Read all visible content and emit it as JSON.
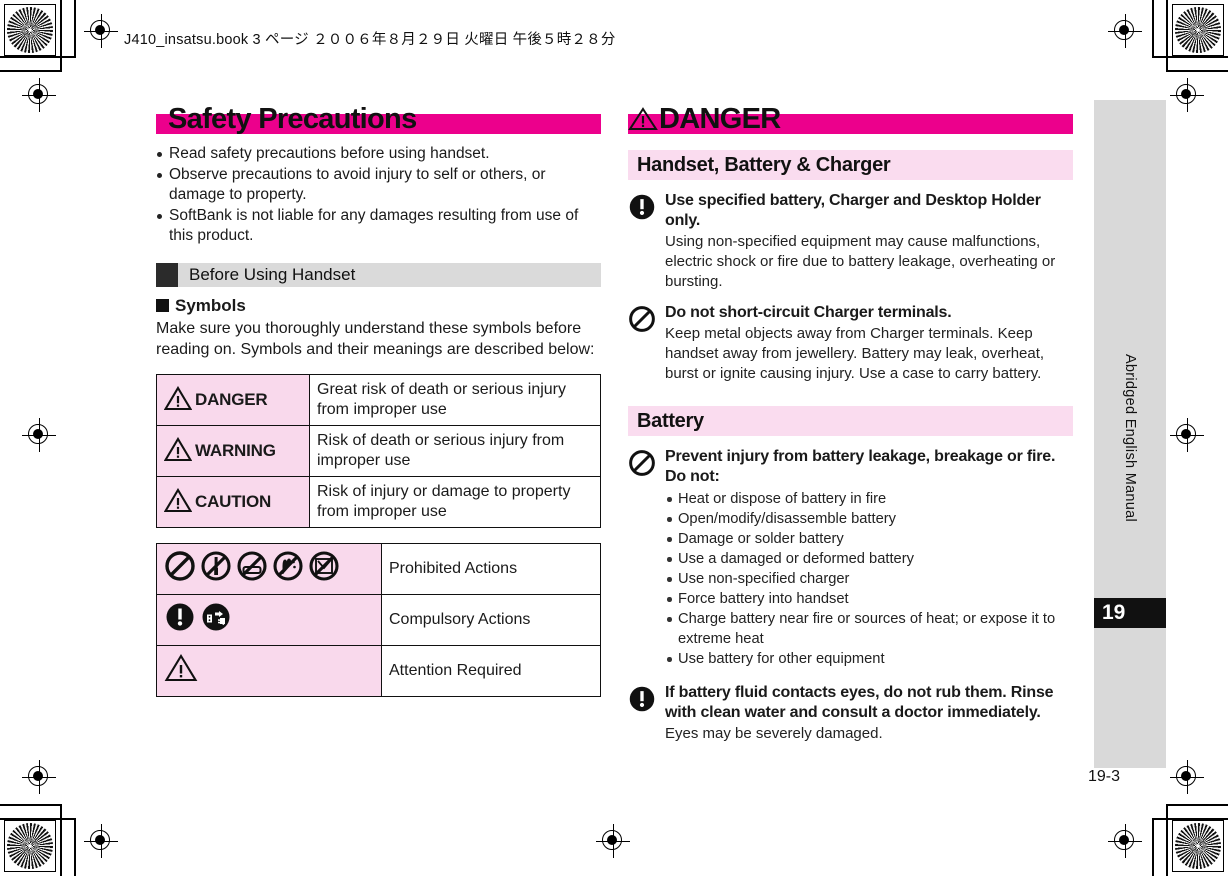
{
  "print_marks": {
    "file_stamp": "J410_insatsu.book  3 ページ  ２００６年８月２９日   火曜日   午後５時２８分"
  },
  "left_column": {
    "title": "Safety Precautions",
    "intro_bullets": [
      "Read safety precautions before using handset.",
      "Observe precautions to avoid injury to self or others, or damage to property.",
      "SoftBank is not liable for any damages resulting from use of this product."
    ],
    "section_heading": "Before Using Handset",
    "sub_heading": "Symbols",
    "paragraph": "Make sure you thoroughly understand these symbols before reading on. Symbols and their meanings are described below:",
    "levels_table": [
      {
        "name": "DANGER",
        "icon": "warning-triangle-icon",
        "desc": "Great risk of death or serious injury from improper use"
      },
      {
        "name": "WARNING",
        "icon": "warning-triangle-icon",
        "desc": "Risk of death or serious injury from improper use"
      },
      {
        "name": "CAUTION",
        "icon": "warning-triangle-icon",
        "desc": "Risk of injury or damage to property from improper use"
      }
    ],
    "symbols_table": [
      {
        "label": "Prohibited Actions",
        "icons": [
          "prohibited-icon",
          "no-disassemble-icon",
          "no-bath-icon",
          "no-wet-hands-icon",
          "no-liquid-icon"
        ]
      },
      {
        "label": "Compulsory Actions",
        "icons": [
          "compulsory-icon",
          "unplug-icon"
        ]
      },
      {
        "label": "Attention Required",
        "icons": [
          "warning-triangle-icon"
        ]
      }
    ]
  },
  "right_column": {
    "title": "DANGER",
    "title_icon": "warning-triangle-icon",
    "sections": [
      {
        "heading": "Handset, Battery & Charger",
        "items": [
          {
            "icon": "compulsory-icon",
            "heading": "Use specified battery, Charger and Desktop Holder only.",
            "body": "Using non-specified equipment may cause malfunctions, electric shock or fire due to battery leakage, overheating or bursting.",
            "bullets": []
          },
          {
            "icon": "prohibited-icon",
            "heading": "Do not short-circuit Charger terminals.",
            "body": "Keep metal objects away from Charger terminals. Keep handset away from jewellery. Battery may leak, overheat, burst or ignite causing injury. Use a case to carry battery.",
            "bullets": []
          }
        ]
      },
      {
        "heading": "Battery",
        "items": [
          {
            "icon": "prohibited-icon",
            "heading": "Prevent injury from battery leakage, breakage or fire. Do not:",
            "body": "",
            "bullets": [
              "Heat or dispose of battery in fire",
              "Open/modify/disassemble battery",
              "Damage or solder battery",
              "Use a damaged or deformed battery",
              "Use non-specified charger",
              "Force battery into handset",
              "Charge battery near fire or sources of heat; or expose it to extreme heat",
              "Use battery for other equipment"
            ]
          },
          {
            "icon": "compulsory-icon",
            "heading": "If battery fluid contacts eyes, do not rub them. Rinse with clean water and consult a doctor immediately.",
            "body": "Eyes may be severely damaged.",
            "bullets": []
          }
        ]
      }
    ]
  },
  "side_tab": {
    "manual_label": "Abridged English Manual",
    "chapter_number": "19"
  },
  "footer": {
    "page_number": "19-3"
  },
  "colors": {
    "magenta": "#ec008c",
    "light_pink": "#fadcef",
    "table_pink": "#f9d9ec",
    "grey_bar": "#dadada",
    "side_tab_grey": "#d9d9d9"
  }
}
